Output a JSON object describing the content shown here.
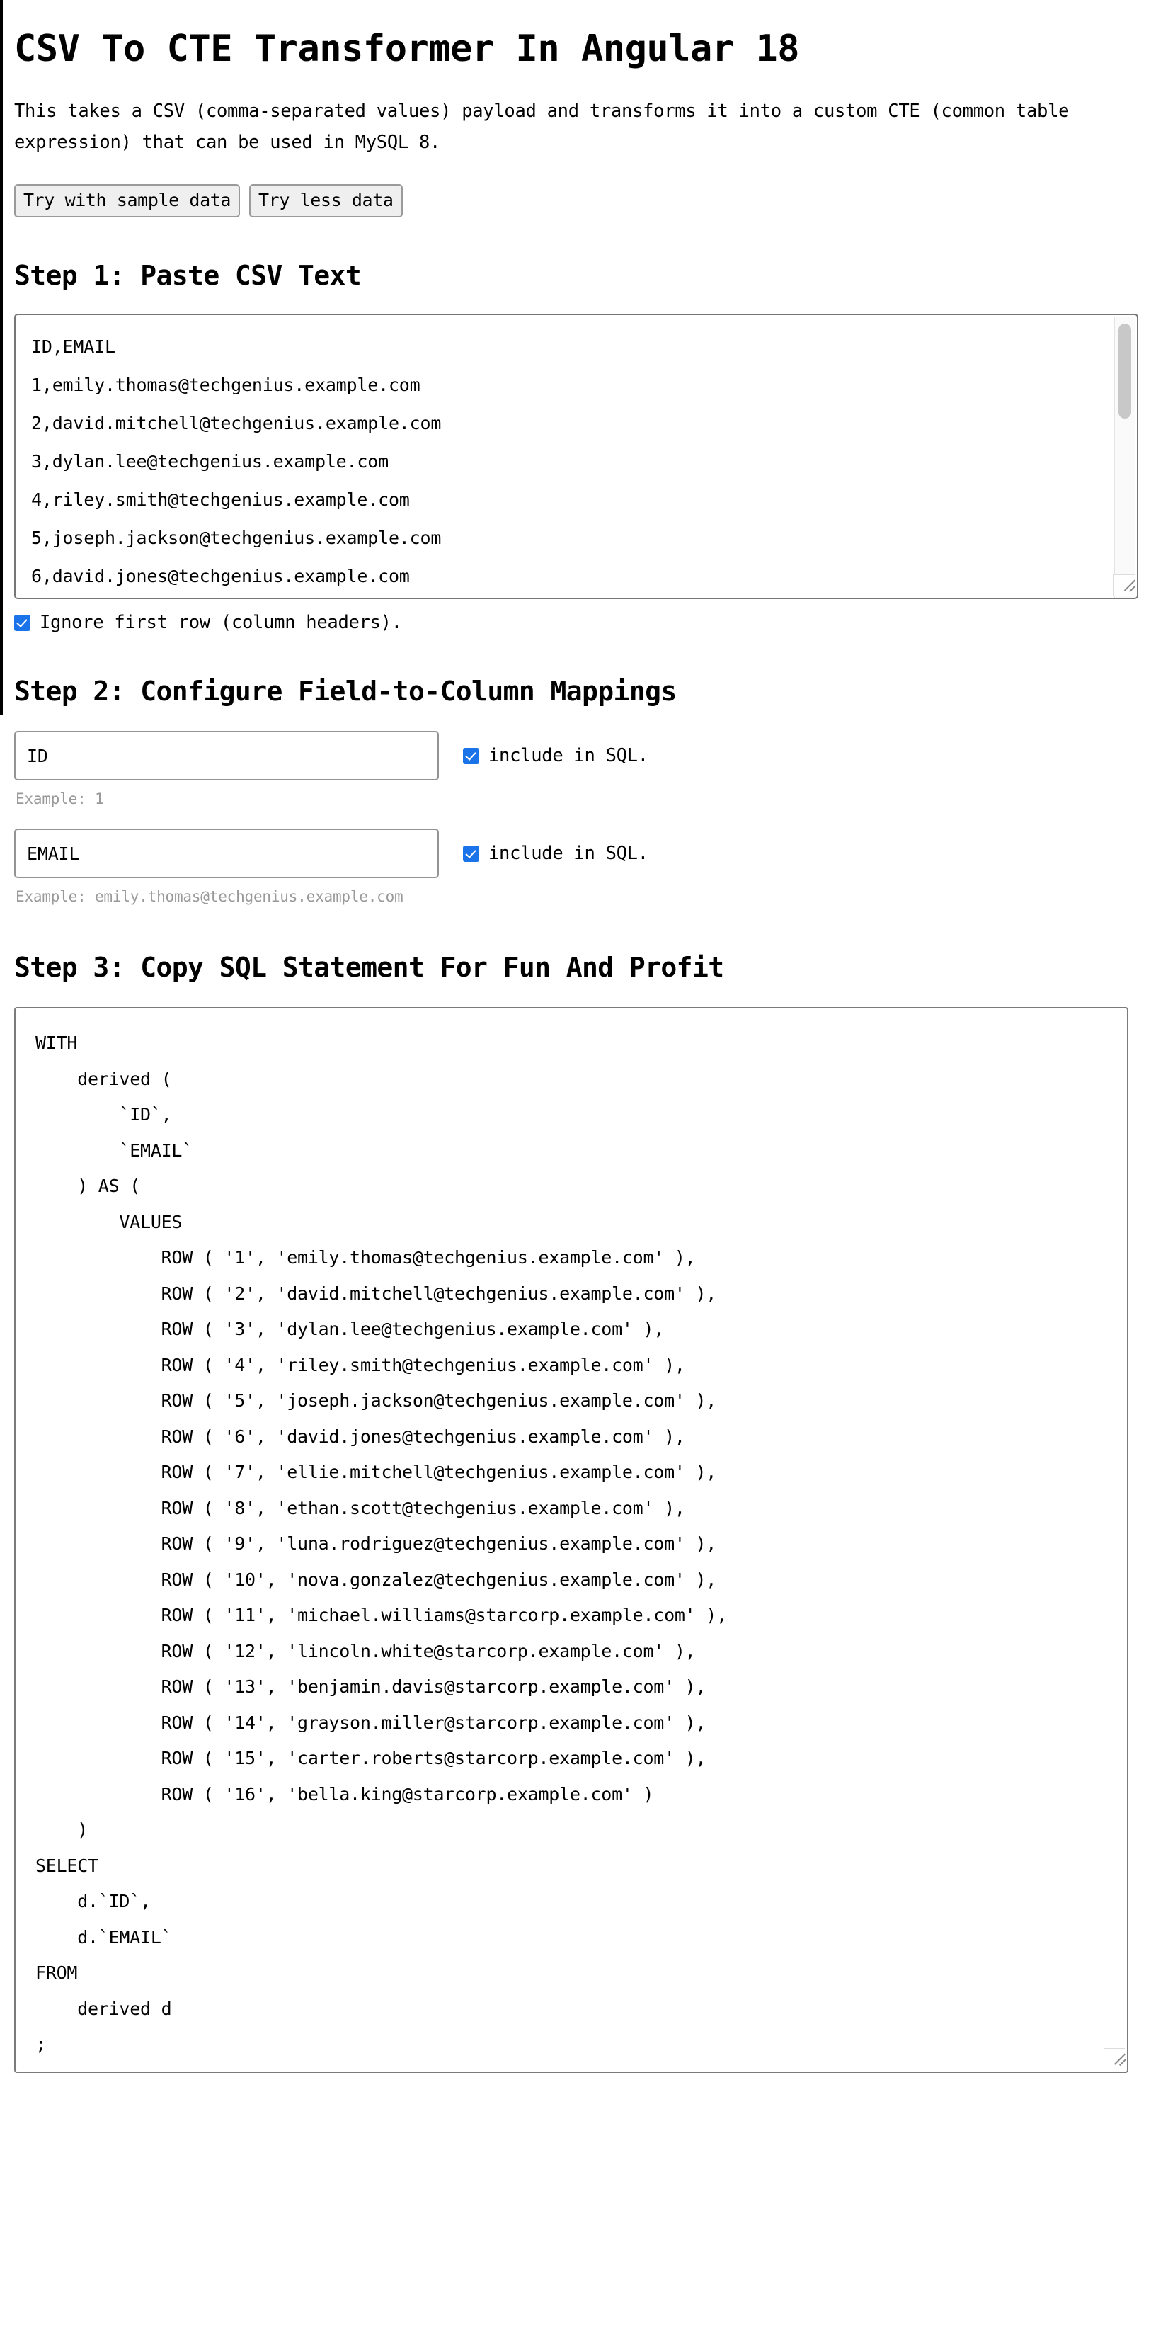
{
  "header": {
    "title": "CSV To CTE Transformer In Angular 18",
    "intro": "This takes a CSV (comma-separated values) payload and transforms it into a custom CTE (common table expression) that can be used in MySQL 8."
  },
  "actions": {
    "sample_data_label": "Try with sample data",
    "less_data_label": "Try less data"
  },
  "step1": {
    "title": "Step 1: Paste CSV Text",
    "csv_value": "ID,EMAIL\n1,emily.thomas@techgenius.example.com\n2,david.mitchell@techgenius.example.com\n3,dylan.lee@techgenius.example.com\n4,riley.smith@techgenius.example.com\n5,joseph.jackson@techgenius.example.com\n6,david.jones@techgenius.example.com",
    "ignore_first_row_label": "Ignore first row (column headers).",
    "ignore_first_row_checked": true
  },
  "step2": {
    "title": "Step 2: Configure Field-to-Column Mappings",
    "include_label": "include in SQL.",
    "mappings": [
      {
        "column_name": "ID",
        "include": true,
        "example": "Example: 1"
      },
      {
        "column_name": "EMAIL",
        "include": true,
        "example": "Example: emily.thomas@techgenius.example.com"
      }
    ]
  },
  "step3": {
    "title": "Step 3: Copy SQL Statement For Fun And Profit",
    "sql": "WITH\n    derived (\n        `ID`,\n        `EMAIL`\n    ) AS (\n        VALUES\n            ROW ( '1', 'emily.thomas@techgenius.example.com' ),\n            ROW ( '2', 'david.mitchell@techgenius.example.com' ),\n            ROW ( '3', 'dylan.lee@techgenius.example.com' ),\n            ROW ( '4', 'riley.smith@techgenius.example.com' ),\n            ROW ( '5', 'joseph.jackson@techgenius.example.com' ),\n            ROW ( '6', 'david.jones@techgenius.example.com' ),\n            ROW ( '7', 'ellie.mitchell@techgenius.example.com' ),\n            ROW ( '8', 'ethan.scott@techgenius.example.com' ),\n            ROW ( '9', 'luna.rodriguez@techgenius.example.com' ),\n            ROW ( '10', 'nova.gonzalez@techgenius.example.com' ),\n            ROW ( '11', 'michael.williams@starcorp.example.com' ),\n            ROW ( '12', 'lincoln.white@starcorp.example.com' ),\n            ROW ( '13', 'benjamin.davis@starcorp.example.com' ),\n            ROW ( '14', 'grayson.miller@starcorp.example.com' ),\n            ROW ( '15', 'carter.roberts@starcorp.example.com' ),\n            ROW ( '16', 'bella.king@starcorp.example.com' )\n    )\nSELECT\n    d.`ID`,\n    d.`EMAIL`\nFROM\n    derived d\n;"
  },
  "colors": {
    "checkbox_accent": "#1a73e8",
    "button_background": "#efefef",
    "button_border": "#9a9a9a",
    "muted_text": "#999999",
    "scrollbar_thumb": "#c8c8c8"
  }
}
